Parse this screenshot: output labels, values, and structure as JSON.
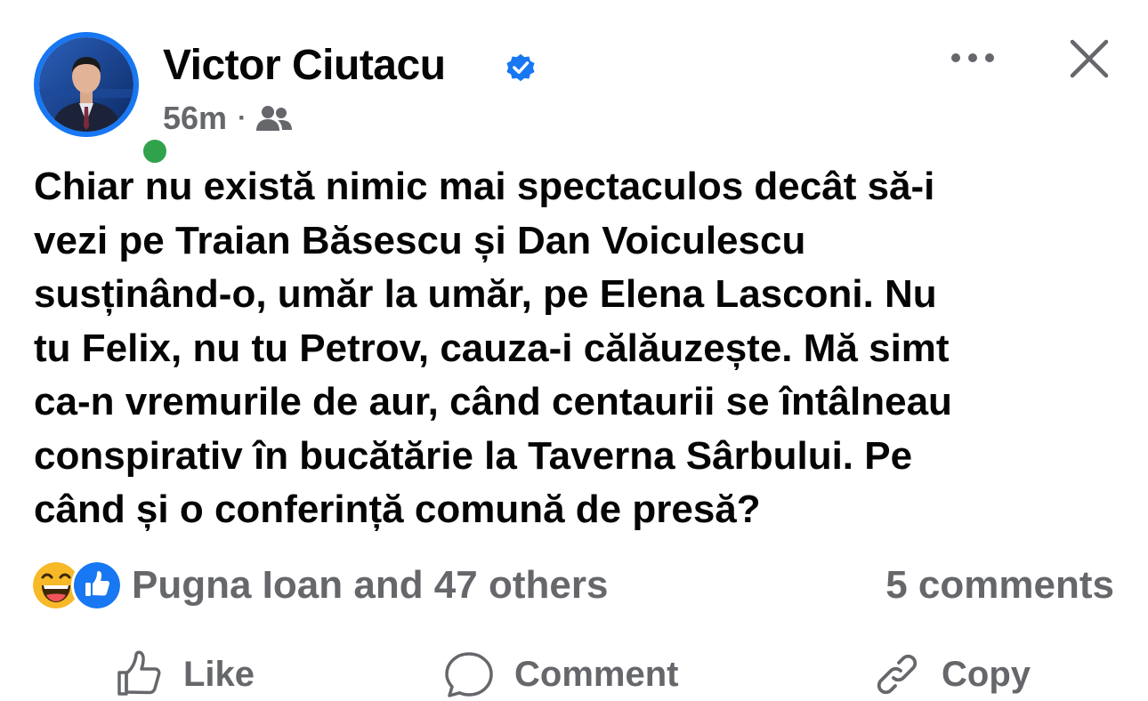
{
  "post": {
    "author": "Victor Ciutacu",
    "time": "56m",
    "separator": "·",
    "audience_icon": "friends-icon",
    "text_lines": [
      "Chiar nu există nimic mai spectaculos decât să-i",
      "vezi pe Traian Băsescu și Dan Voiculescu",
      "susținând-o, umăr la umăr, pe Elena Lasconi. Nu",
      "tu Felix, nu tu Petrov, cauza-i călăuzește. Mă simt",
      "ca-n vremurile de aur, când centaurii se întâlneau",
      "conspirativ în bucătărie la Taverna Sârbului. Pe",
      "când și o conferință comună de presă?"
    ]
  },
  "reactions": {
    "icons": [
      "haha-icon",
      "like-icon"
    ],
    "label": "Pugna Ioan and 47 others",
    "comments": "5 comments"
  },
  "actions": {
    "like": "Like",
    "comment": "Comment",
    "copy": "Copy"
  },
  "colors": {
    "brand_blue": "#1877f2",
    "online_green": "#31a24c",
    "secondary_text": "#65676b",
    "haha_yellow": "#f7b928"
  }
}
